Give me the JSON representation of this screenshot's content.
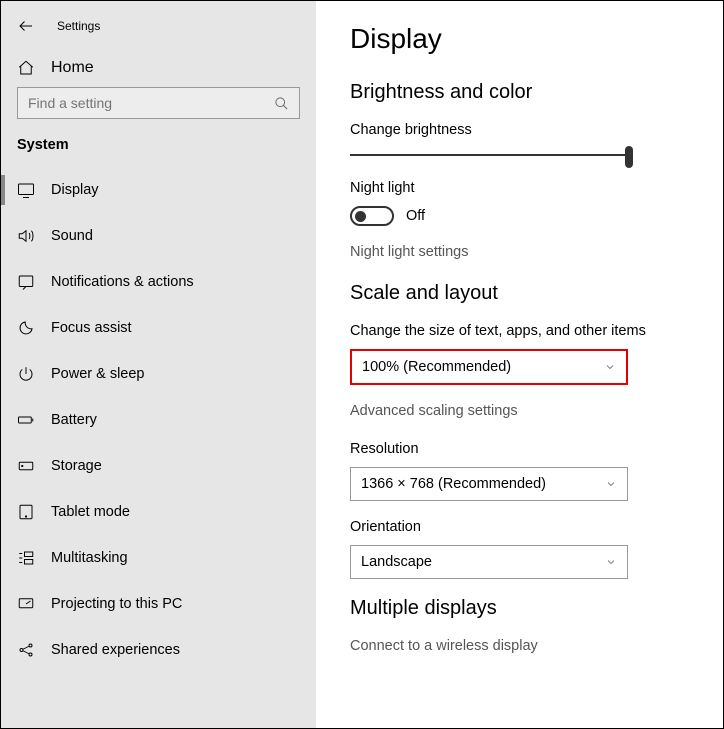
{
  "window": {
    "title": "Settings"
  },
  "home": {
    "label": "Home"
  },
  "search": {
    "placeholder": "Find a setting"
  },
  "section": {
    "label": "System"
  },
  "nav": [
    {
      "id": "display",
      "label": "Display",
      "active": true
    },
    {
      "id": "sound",
      "label": "Sound"
    },
    {
      "id": "notifications",
      "label": "Notifications & actions"
    },
    {
      "id": "focus",
      "label": "Focus assist"
    },
    {
      "id": "power",
      "label": "Power & sleep"
    },
    {
      "id": "battery",
      "label": "Battery"
    },
    {
      "id": "storage",
      "label": "Storage"
    },
    {
      "id": "tablet",
      "label": "Tablet mode"
    },
    {
      "id": "multitask",
      "label": "Multitasking"
    },
    {
      "id": "projecting",
      "label": "Projecting to this PC"
    },
    {
      "id": "shared",
      "label": "Shared experiences"
    }
  ],
  "page": {
    "title": "Display",
    "brightness": {
      "heading": "Brightness and color",
      "change_label": "Change brightness",
      "nightlight_label": "Night light",
      "nightlight_state": "Off",
      "nightlight_settings": "Night light settings"
    },
    "scale": {
      "heading": "Scale and layout",
      "size_label": "Change the size of text, apps, and other items",
      "size_value": "100% (Recommended)",
      "advanced": "Advanced scaling settings",
      "resolution_label": "Resolution",
      "resolution_value": "1366 × 768 (Recommended)",
      "orientation_label": "Orientation",
      "orientation_value": "Landscape"
    },
    "multiple": {
      "heading": "Multiple displays",
      "connect": "Connect to a wireless display"
    }
  }
}
